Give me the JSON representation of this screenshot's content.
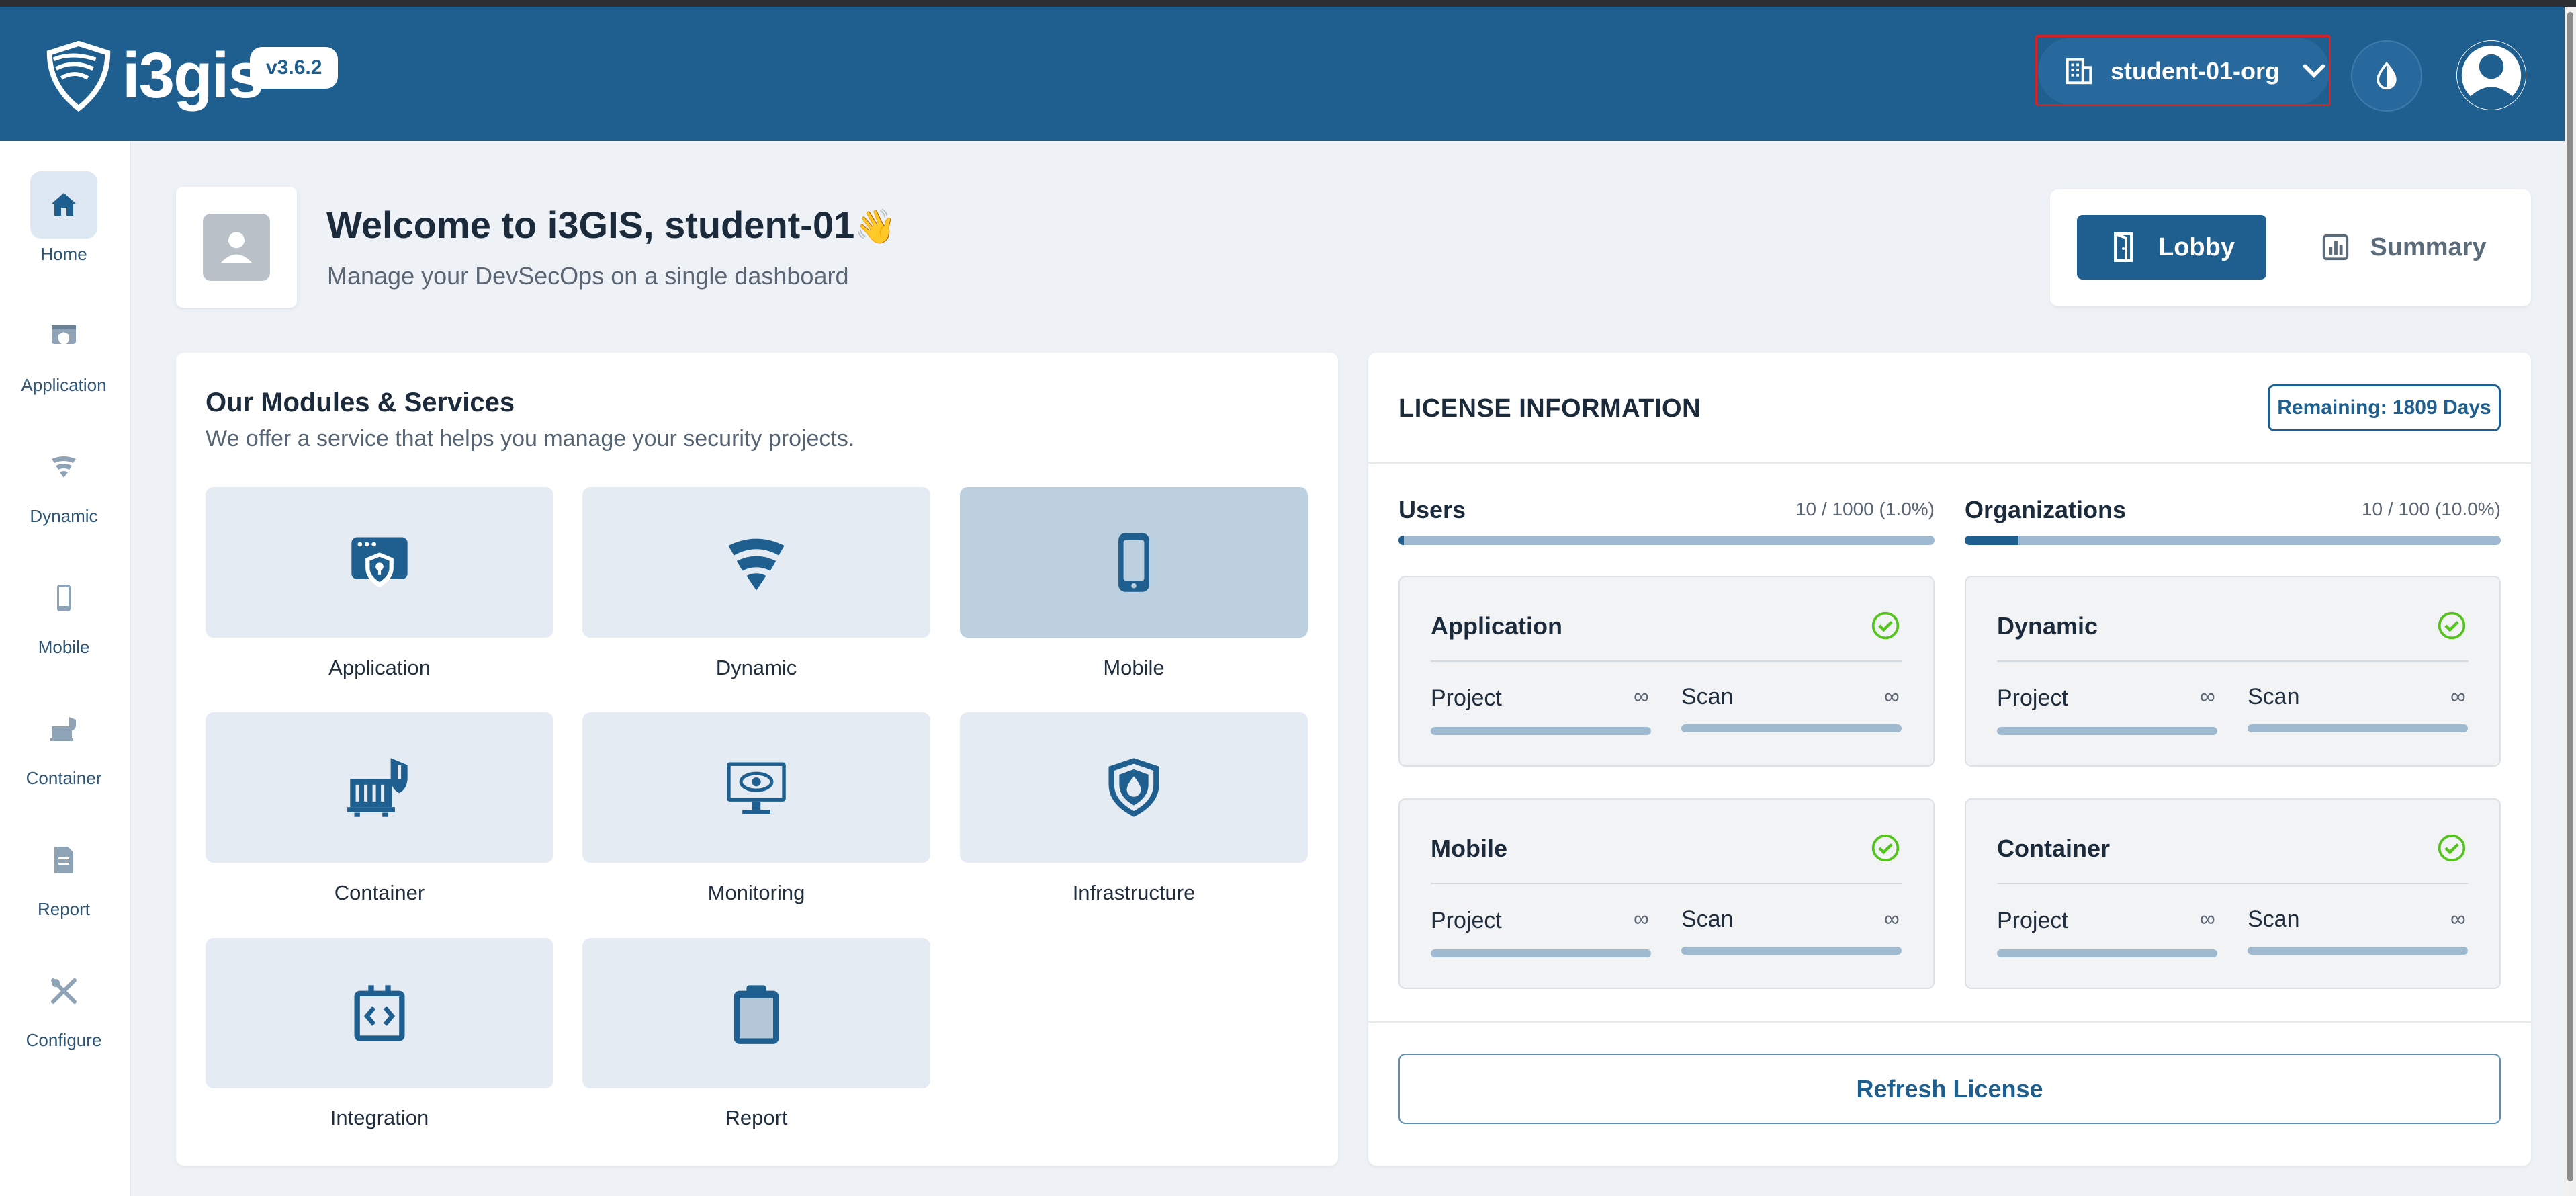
{
  "header": {
    "brand": "i3gis",
    "version": "v3.6.2",
    "org_select": {
      "value": "student-01-org"
    },
    "theme_toggle": "droplet-icon",
    "avatar": "user-icon",
    "brand_color": "#1e5f8f"
  },
  "sidebar": {
    "items": [
      {
        "label": "Home",
        "icon": "home-icon",
        "active": true
      },
      {
        "label": "Application",
        "icon": "application-icon"
      },
      {
        "label": "Dynamic",
        "icon": "dynamic-icon"
      },
      {
        "label": "Mobile",
        "icon": "mobile-icon"
      },
      {
        "label": "Container",
        "icon": "container-icon"
      },
      {
        "label": "Report",
        "icon": "report-icon"
      },
      {
        "label": "Configure",
        "icon": "configure-icon"
      }
    ]
  },
  "welcome": {
    "title": "Welcome to i3GIS, student-01",
    "wave": "👋",
    "subtitle": "Manage your DevSecOps on a single dashboard"
  },
  "view_tabs": [
    {
      "label": "Lobby",
      "active": true
    },
    {
      "label": "Summary",
      "active": false
    }
  ],
  "modules": {
    "title": "Our Modules & Services",
    "subtitle": "We offer a service that helps you manage your security projects.",
    "items": [
      {
        "label": "Application",
        "icon": "application-icon"
      },
      {
        "label": "Dynamic",
        "icon": "dynamic-icon"
      },
      {
        "label": "Mobile",
        "icon": "mobile-icon",
        "selected": true
      },
      {
        "label": "Container",
        "icon": "container-icon"
      },
      {
        "label": "Monitoring",
        "icon": "monitoring-icon"
      },
      {
        "label": "Infrastructure",
        "icon": "infrastructure-icon"
      },
      {
        "label": "Integration",
        "icon": "integration-icon"
      },
      {
        "label": "Report",
        "icon": "report-icon"
      }
    ]
  },
  "license": {
    "title": "LICENSE INFORMATION",
    "remaining": "Remaining: 1809 Days",
    "users": {
      "label": "Users",
      "value": "10 / 1000  (1.0%)",
      "fraction": 0.01
    },
    "organizations": {
      "label": "Organizations",
      "value": "10 / 100  (10.0%)",
      "fraction": 0.1
    },
    "services": [
      {
        "name": "Application",
        "project_label": "Project",
        "project_value": "∞",
        "scan_label": "Scan",
        "scan_value": "∞",
        "status": "check-icon"
      },
      {
        "name": "Dynamic",
        "project_label": "Project",
        "project_value": "∞",
        "scan_label": "Scan",
        "scan_value": "∞",
        "status": "check-icon"
      },
      {
        "name": "Mobile",
        "project_label": "Project",
        "project_value": "∞",
        "scan_label": "Scan",
        "scan_value": "∞",
        "status": "check-icon"
      },
      {
        "name": "Container",
        "project_label": "Project",
        "project_value": "∞",
        "scan_label": "Scan",
        "scan_value": "∞",
        "status": "check-icon"
      }
    ],
    "refresh_label": "Refresh License",
    "check_color": "#52c41a"
  }
}
